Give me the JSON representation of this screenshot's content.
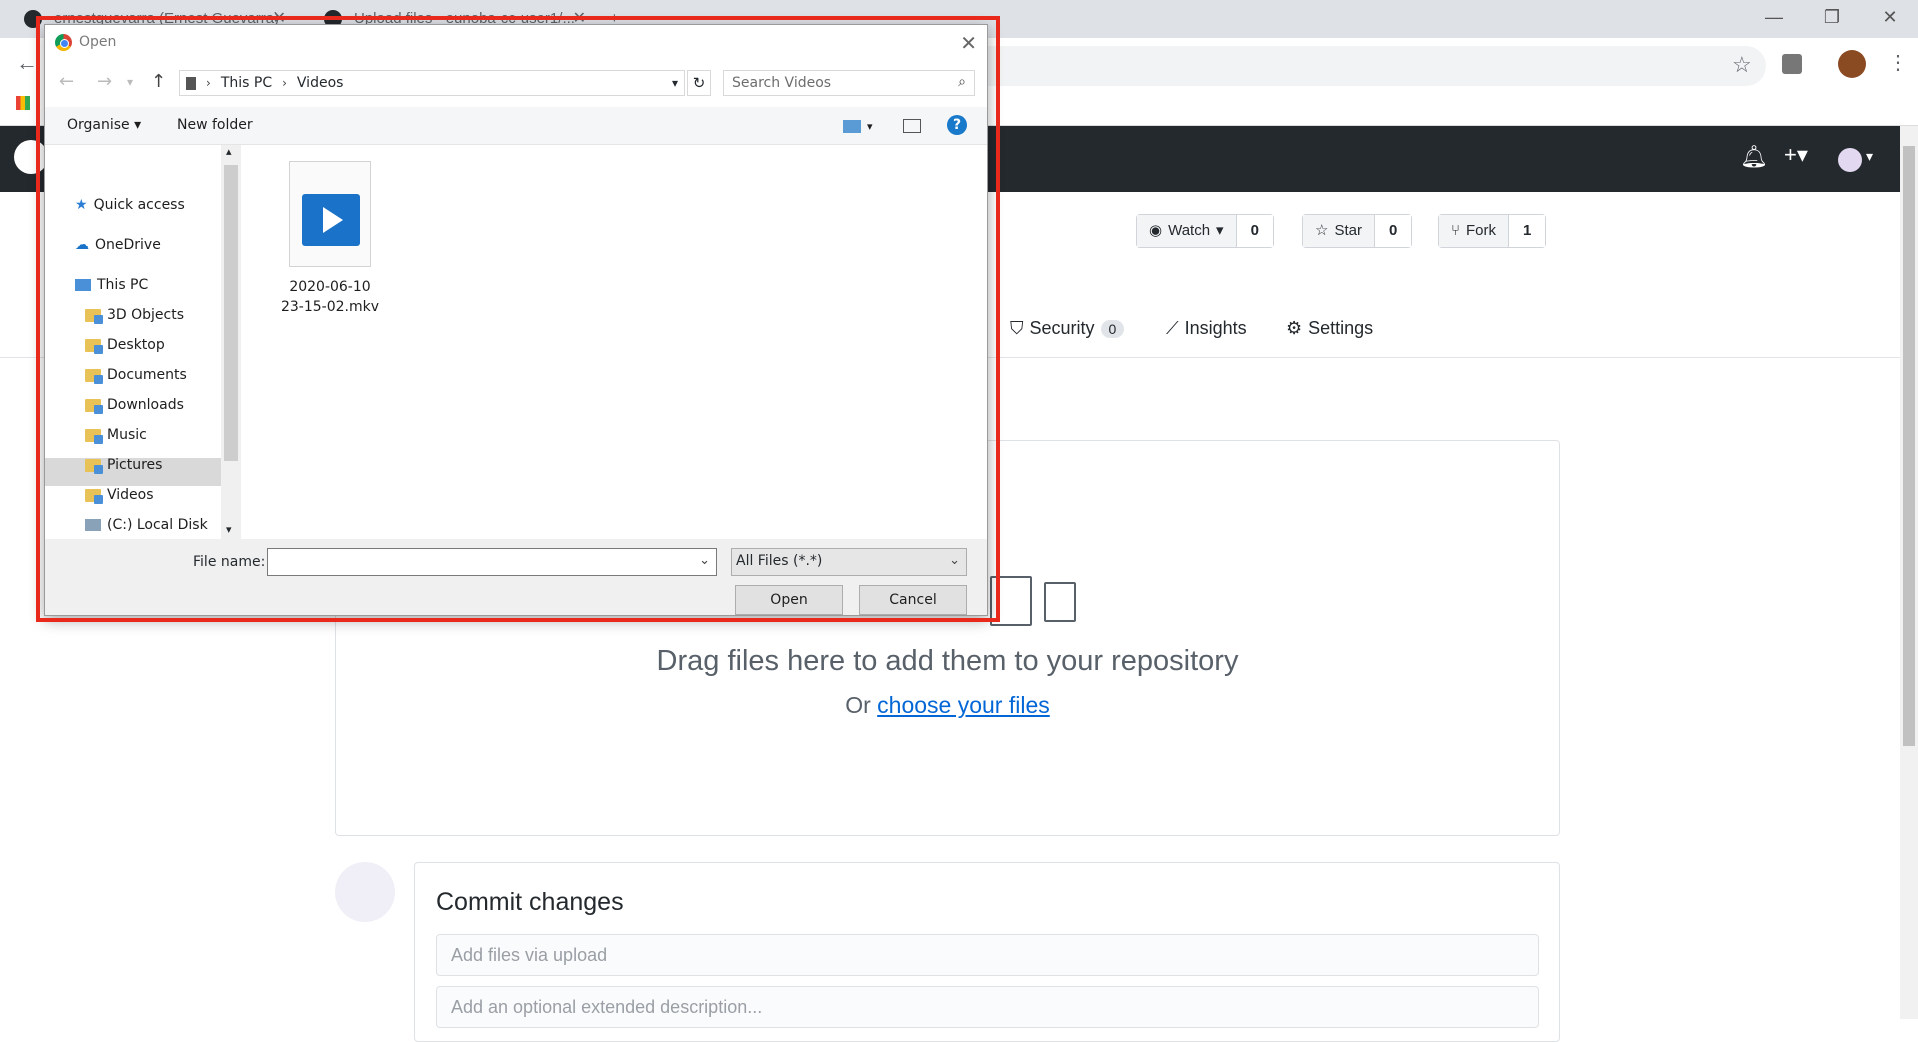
{
  "browser": {
    "tabs": [
      {
        "title": "ernestguevarra (Ernest Guevarra)"
      },
      {
        "title": "Upload files · eunoba-cc-user1/..."
      }
    ],
    "window_controls": {
      "minimize": "—",
      "restore": "❐",
      "close": "✕"
    }
  },
  "repo": {
    "watch": {
      "label": "Watch",
      "count": "0"
    },
    "star": {
      "label": "Star",
      "count": "0"
    },
    "fork": {
      "label": "Fork",
      "count": "1"
    },
    "nav": {
      "security_label": "Security",
      "security_count": "0",
      "insights_label": "Insights",
      "settings_label": "Settings"
    }
  },
  "upload": {
    "drag_text": "Drag files here to add them to your repository",
    "or_text": "Or ",
    "choose_link": "choose your files"
  },
  "commit": {
    "title": "Commit changes",
    "summary_placeholder": "Add files via upload",
    "description_placeholder": "Add an optional extended description..."
  },
  "dialog": {
    "title": "Open",
    "breadcrumb": [
      "This PC",
      "Videos"
    ],
    "search_placeholder": "Search Videos",
    "toolbar": {
      "organise": "Organise",
      "new_folder": "New folder",
      "help": "?"
    },
    "nav_items": [
      {
        "label": "Quick access",
        "icon": "star-icon"
      },
      {
        "label": "OneDrive",
        "icon": "cloud-icon"
      },
      {
        "label": "This PC",
        "icon": "computer-icon"
      },
      {
        "label": "3D Objects",
        "icon": "folder-icon"
      },
      {
        "label": "Desktop",
        "icon": "folder-icon"
      },
      {
        "label": "Documents",
        "icon": "folder-icon"
      },
      {
        "label": "Downloads",
        "icon": "folder-icon"
      },
      {
        "label": "Music",
        "icon": "folder-icon"
      },
      {
        "label": "Pictures",
        "icon": "folder-icon"
      },
      {
        "label": "Videos",
        "icon": "folder-icon",
        "selected": true
      },
      {
        "label": "(C:) Local Disk",
        "icon": "drive-icon"
      }
    ],
    "files": [
      {
        "name_line1": "2020-06-10",
        "name_line2": "23-15-02.mkv",
        "icon": "video-file-icon"
      }
    ],
    "file_name_label": "File name:",
    "file_name_value": "",
    "filter_value": "All Files (*.*)",
    "open_button": "Open",
    "cancel_button": "Cancel"
  },
  "colors": {
    "highlight_box": "#e8291c",
    "github_header": "#24292e",
    "link": "#0366d6"
  }
}
